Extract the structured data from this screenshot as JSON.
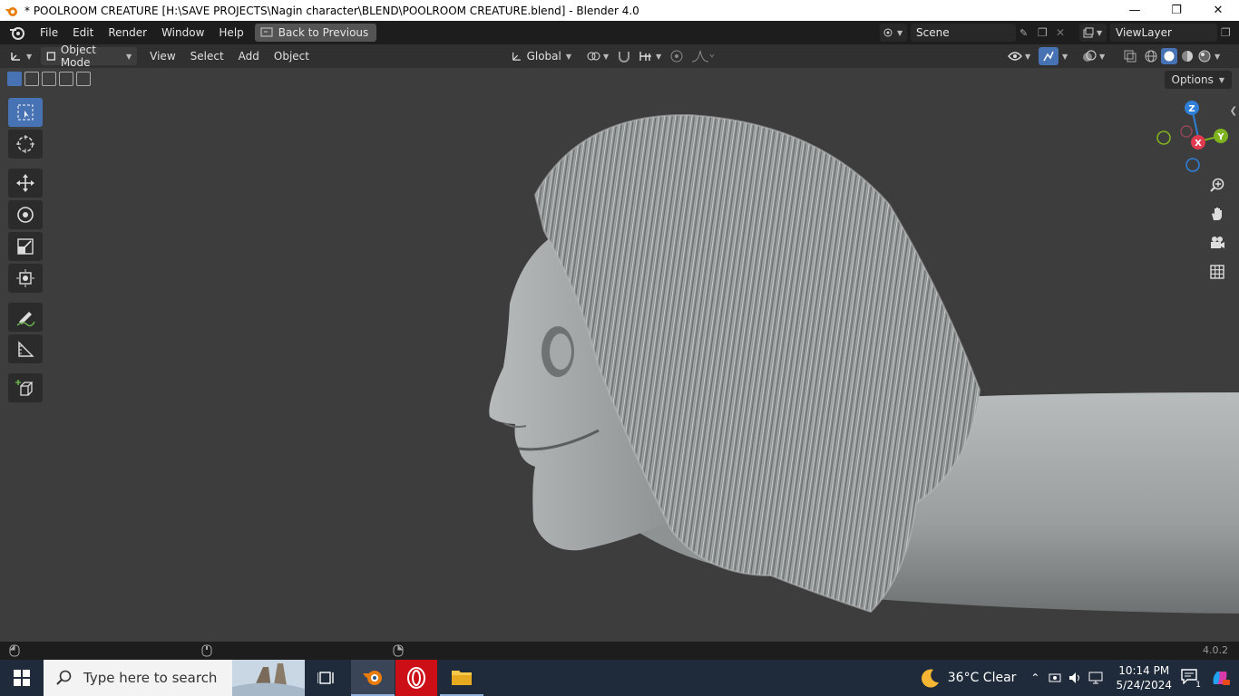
{
  "window": {
    "title": "* POOLROOM CREATURE [H:\\SAVE PROJECTS\\Nagin character\\BLEND\\POOLROOM CREATURE.blend] - Blender 4.0"
  },
  "topbar": {
    "menu": [
      "File",
      "Edit",
      "Render",
      "Window",
      "Help"
    ],
    "back_label": "Back to Previous",
    "scene": "Scene",
    "view_layer": "ViewLayer"
  },
  "viewport_header": {
    "mode": "Object Mode",
    "menu": [
      "View",
      "Select",
      "Add",
      "Object"
    ],
    "orientation": "Global",
    "options_label": "Options"
  },
  "gizmo": {
    "x": "X",
    "y": "Y",
    "z": "Z"
  },
  "statusbar": {
    "version": "4.0.2"
  },
  "taskbar": {
    "search_placeholder": "Type here to search",
    "weather": "36°C  Clear",
    "time": "10:14 PM",
    "date": "5/24/2024",
    "notification_count": "1"
  },
  "colors": {
    "accent": "#4772b3",
    "axis_x": "#e03a4f",
    "axis_y": "#7fb21f",
    "axis_z": "#2f7fd8"
  }
}
